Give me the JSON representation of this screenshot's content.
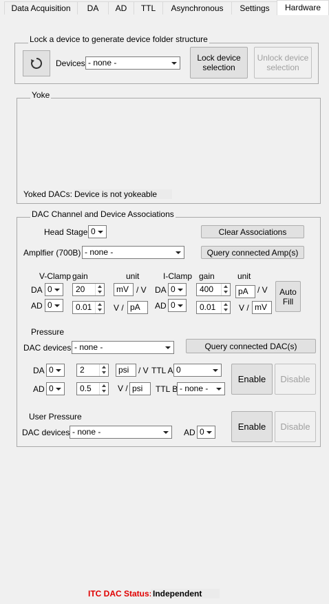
{
  "tabs": [
    {
      "label": "Data Acquisition"
    },
    {
      "label": "DA"
    },
    {
      "label": "AD"
    },
    {
      "label": "TTL"
    },
    {
      "label": "Asynchronous"
    },
    {
      "label": "Settings"
    },
    {
      "label": "Hardware"
    }
  ],
  "active_tab": "Hardware",
  "lock_group": {
    "title": "Lock a device to generate device folder structure",
    "refresh_icon": "refresh-icon",
    "devices_label": "Devices",
    "devices_value": "- none -",
    "lock_button": "Lock device selection",
    "unlock_button": "Unlock device selection"
  },
  "yoke_group": {
    "title": "Yoke",
    "yoked_label": "Yoked DACs:",
    "yoked_value": "Device is not yokeable"
  },
  "dac_group": {
    "title": "DAC Channel and Device Associations",
    "head_stage_label": "Head Stage",
    "head_stage_value": "0",
    "clear_button": "Clear Associations",
    "amplifier_label": "Amplfier (700B)",
    "amplifier_value": "- none -",
    "query_amp_button": "Query connected Amp(s)",
    "vclamp": {
      "title": "V-Clamp",
      "gain_header": "gain",
      "unit_header": "unit",
      "da_label": "DA",
      "da_value": "0",
      "da_gain": "20",
      "da_unit": "mV",
      "da_per": "/ V",
      "ad_label": "AD",
      "ad_value": "0",
      "ad_gain": "0.01",
      "ad_per": "V /",
      "ad_unit": "pA"
    },
    "iclamp": {
      "title": "I-Clamp",
      "gain_header": "gain",
      "unit_header": "unit",
      "da_label": "DA",
      "da_value": "0",
      "da_gain": "400",
      "da_unit": "pA",
      "da_per": "/ V",
      "ad_label": "AD",
      "ad_value": "0",
      "ad_gain": "0.01",
      "ad_per": "V /",
      "ad_unit": "mV"
    },
    "auto_fill_button": "Auto Fill",
    "pressure": {
      "title": "Pressure",
      "dac_devices_label": "DAC devices",
      "dac_devices_value": "- none -",
      "query_dac_button": "Query connected DAC(s)",
      "da_label": "DA",
      "da_value": "0",
      "da_gain": "2",
      "da_unit": "psi",
      "da_per": "/ V",
      "ad_label": "AD",
      "ad_value": "0",
      "ad_gain": "0.5",
      "ad_per": "V /",
      "ad_unit": "psi",
      "ttl_a_label": "TTL A",
      "ttl_a_value": "0",
      "ttl_b_label": "TTL B",
      "ttl_b_value": "- none -",
      "enable_button": "Enable",
      "disable_button": "Disable"
    },
    "user_pressure": {
      "title": "User Pressure",
      "dac_devices_label": "DAC devices",
      "dac_devices_value": "- none -",
      "ad_label": "AD",
      "ad_value": "0",
      "enable_button": "Enable",
      "disable_button": "Disable"
    }
  },
  "status": {
    "label": "ITC DAC Status:",
    "value": "Independent"
  }
}
